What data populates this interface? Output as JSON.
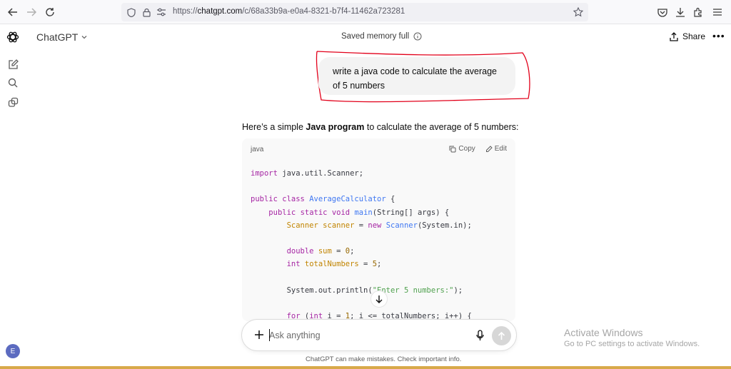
{
  "browser": {
    "url_prefix": "https://",
    "url_host": "chatgpt.com",
    "url_path": "/c/68a33b9a-e0a4-8321-b7f4-11462a723281"
  },
  "header": {
    "app_title": "ChatGPT",
    "memory_status": "Saved memory full",
    "share_label": "Share",
    "more_label": "•••"
  },
  "user_message": {
    "text": "write a java code to calculate the average of 5 numbers"
  },
  "assistant": {
    "intro_before": "Here’s a simple ",
    "intro_bold": "Java program",
    "intro_after": " to calculate the average of 5 numbers:",
    "code_language": "java",
    "copy_label": "Copy",
    "edit_label": "Edit",
    "code_lines": [
      "import java.util.Scanner;",
      "",
      "public class AverageCalculator {",
      "    public static void main(String[] args) {",
      "        Scanner scanner = new Scanner(System.in);",
      "",
      "        double sum = 0;",
      "        int totalNumbers = 5;",
      "",
      "        System.out.println(\"Enter 5 numbers:\");",
      "",
      "        for (int i = 1; i <= totalNumbers; i++) {"
    ]
  },
  "composer": {
    "placeholder": "Ask anything",
    "plus_label": "+"
  },
  "footer": {
    "disclaimer": "ChatGPT can make mistakes. Check important info."
  },
  "watermark": {
    "line1": "Activate Windows",
    "line2": "Go to PC settings to activate Windows."
  },
  "sidebar": {
    "avatar_initial": "E"
  },
  "colors": {
    "annotation_red": "#e2001a",
    "avatar_bg": "#5c6bc0"
  }
}
